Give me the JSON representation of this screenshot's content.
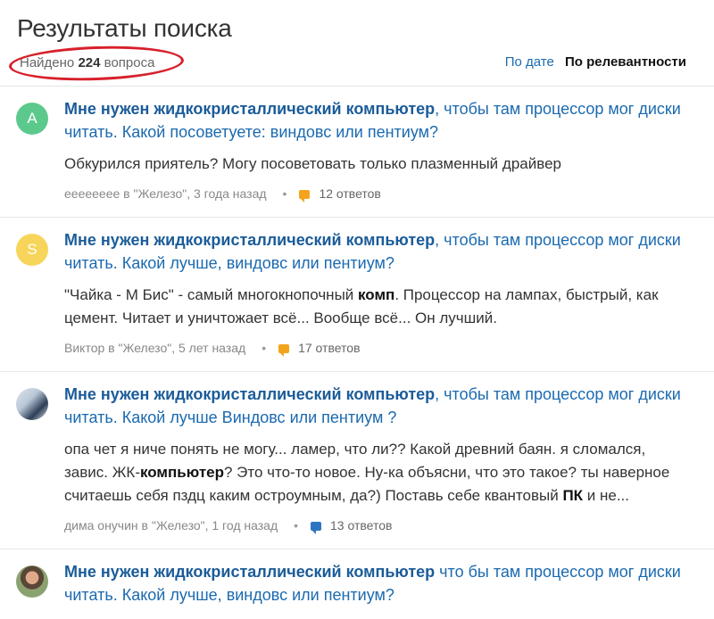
{
  "header": {
    "title": "Результаты поиска",
    "found_prefix": "Найдено",
    "found_count": "224",
    "found_suffix": "вопроса",
    "sort_by_date": "По дате",
    "sort_by_relevance": "По релевантности"
  },
  "colors": {
    "link": "#1b6ab0",
    "annotation_circle": "#d8202b",
    "answers_icon_orange": "#f4a41c",
    "answers_icon_blue": "#2d75c2"
  },
  "results": [
    {
      "avatar_letter": "A",
      "avatar_color": "#5cc98c",
      "title_bold": "Мне нужен жидкокристаллический компьютер",
      "title_rest": ", чтобы там процессор мог диски читать. Какой посоветуете: виндовс или пентиум?",
      "snippet": "Обкурился приятель? Могу посоветовать только плазменный драйвер",
      "meta": "ееееееее в \"Железо\", 3 года назад",
      "answers": "12 ответов",
      "answers_icon": "chat-orange"
    },
    {
      "avatar_letter": "S",
      "avatar_color": "#f7d55a",
      "title_bold": "Мне нужен жидкокристаллический компьютер",
      "title_rest": ", чтобы там процессор мог диски читать. Какой лучше, виндовс или пентиум?",
      "snippet_1": "\"Чайка - М Бис\" - самый многокнопочный ",
      "snippet_bold": "комп",
      "snippet_2": ". Процессор на лампах, быстрый, как цемент. Читает и уничтожает всё... Вообще всё... Он лучший.",
      "meta": "Виктор в \"Железо\", 5 лет назад",
      "answers": "17 ответов",
      "answers_icon": "chat-orange"
    },
    {
      "title_bold": "Мне нужен жидкокристаллический компьютер",
      "title_rest": ", чтобы там процессор мог диски читать. Какой лучше Виндовс или пентиум ?",
      "snippet_1": "опа чет я ниче понять не могу... ламер, что ли?? Какой древний баян. я сломался, завис. ЖК-",
      "snippet_bold_1": "компьютер",
      "snippet_2": "? Это что-то новое. Ну-ка объясни, что это такое? ты наверное считаешь себя пздц каким остроумным, да?) Поставь себе квантовый ",
      "snippet_bold_2": "ПК",
      "snippet_3": " и не...",
      "meta": "дима онучин в \"Железо\", 1 год назад",
      "answers": "13 ответов",
      "answers_icon": "chat-blue"
    },
    {
      "title_bold": "Мне нужен жидкокристаллический компьютер",
      "title_rest": " что бы там процессор мог диски читать. Какой лучше, виндовс или пентиум?"
    }
  ]
}
